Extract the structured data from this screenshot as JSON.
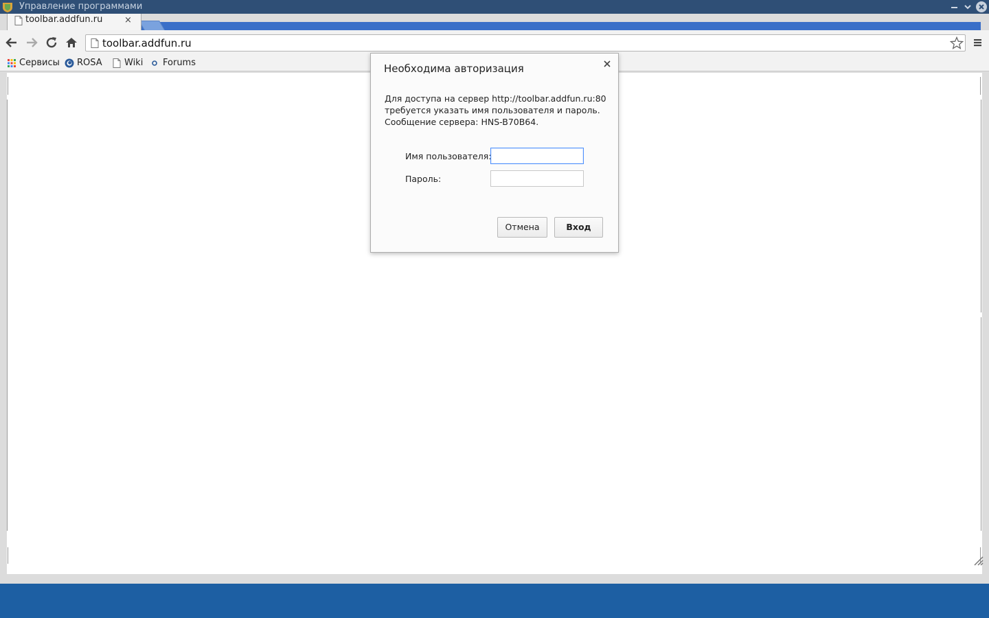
{
  "window": {
    "title": "Управление программами"
  },
  "tab": {
    "title": "toolbar.addfun.ru",
    "close_glyph": "×"
  },
  "omnibox": {
    "url": "toolbar.addfun.ru"
  },
  "bookmarks": [
    {
      "label": "Сервисы",
      "icon": "apps-grid-icon"
    },
    {
      "label": "ROSA",
      "icon": "rosa-logo-icon"
    },
    {
      "label": "Wiki",
      "icon": "page-icon"
    },
    {
      "label": "Forums",
      "icon": "forums-icon"
    }
  ],
  "dialog": {
    "title": "Необходима авторизация",
    "close_glyph": "×",
    "message_lines": [
      "Для доступа на сервер http://toolbar.addfun.ru:80",
      "требуется указать имя пользователя и пароль.",
      "Сообщение сервера: HNS-B70B64."
    ],
    "username_label": "Имя пользователя:",
    "username_value": "",
    "password_label": "Пароль:",
    "password_value": "",
    "cancel_label": "Отмена",
    "login_label": "Вход"
  },
  "colors": {
    "titlebar": "#2f4f76",
    "tab_strip_accent": "#3a6fc8",
    "focus_ring": "#4d90fe",
    "taskbar": "#1d5fa3"
  }
}
